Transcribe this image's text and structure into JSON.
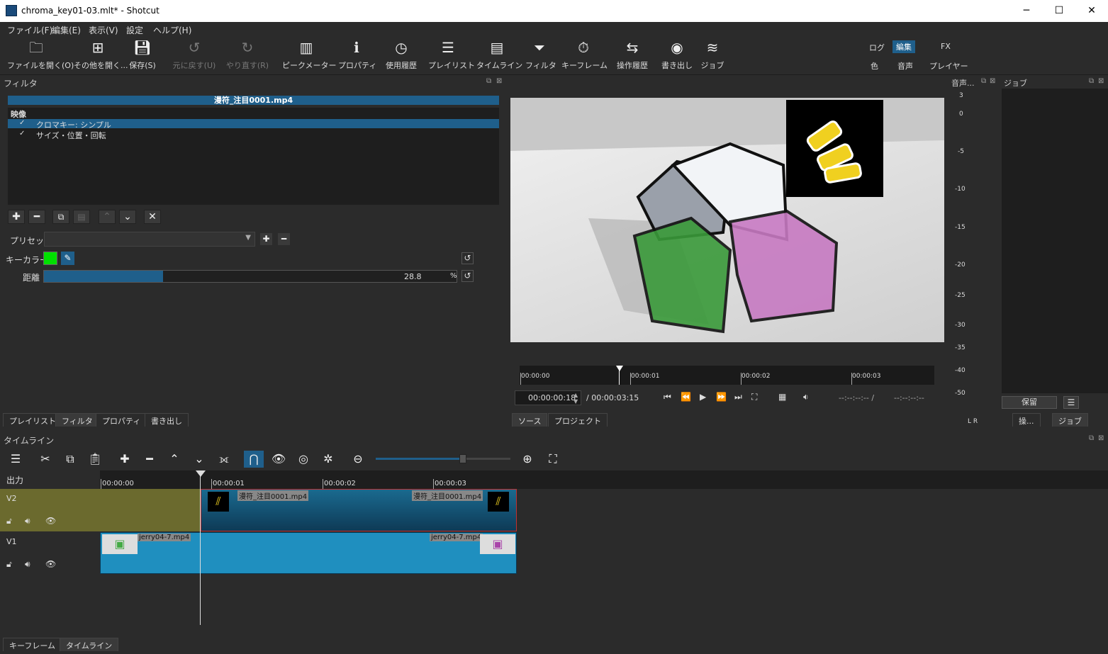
{
  "window": {
    "title": "chroma_key01-03.mlt* - Shotcut",
    "min": "─",
    "max": "☐",
    "close": "✕"
  },
  "menu": [
    "ファイル(F)",
    "編集(E)",
    "表示(V)",
    "設定",
    "ヘルプ(H)"
  ],
  "toolbar": {
    "open": "ファイルを開く(O)",
    "open_other": "その他を開く...",
    "save": "保存(S)",
    "undo": "元に戻す(U)",
    "redo": "やり直す(R)",
    "peak": "ピークメーター",
    "props": "プロパティ",
    "history": "使用履歴",
    "playlist": "プレイリスト",
    "timeline": "タイムライン",
    "filter": "フィルタ",
    "keyframe": "キーフレーム",
    "ophistory": "操作履歴",
    "export": "書き出し",
    "jobs": "ジョブ"
  },
  "layouts": {
    "log": "ログ",
    "edit": "編集",
    "fx": "FX",
    "color": "色",
    "audio": "音声",
    "player": "プレイヤー"
  },
  "filters": {
    "title": "フィルタ",
    "clip": "漫符_注目0001.mp4",
    "section": "映像",
    "items": [
      {
        "label": "クロマキー: シンプル",
        "checked": "✓"
      },
      {
        "label": "サイズ・位置・回転",
        "checked": "✓"
      }
    ],
    "preset_label": "プリセット",
    "key_color_label": "キーカラー",
    "key_color": "#00e000",
    "distance_label": "距離",
    "distance_value": "28.8",
    "distance_unit": "%",
    "distance_fraction": 0.288
  },
  "left_tabs": [
    "プレイリスト",
    "フィルタ",
    "プロパティ",
    "書き出し"
  ],
  "player": {
    "ruler": [
      "00:00:00",
      "00:00:01",
      "00:00:02",
      "00:00:03"
    ],
    "position": "00:00:00:18",
    "duration": "/ 00:00:03:15",
    "in_point": "--:--:--:-- /",
    "out_point": "--:--:--:--",
    "tabs": [
      "ソース",
      "プロジェクト"
    ]
  },
  "audio_meter": {
    "title": "音声...",
    "scale": [
      "3",
      "0",
      "-5",
      "-10",
      "-15",
      "-20",
      "-25",
      "-30",
      "-35",
      "-40",
      "-50"
    ],
    "lr": "L R"
  },
  "jobs": {
    "title": "ジョブ",
    "pause_button": "保留",
    "tabs": [
      "操...",
      "ジョブ"
    ]
  },
  "timeline": {
    "title": "タイムライン",
    "output_label": "出力",
    "ruler": [
      "00:00:00",
      "00:00:01",
      "00:00:02",
      "00:00:03"
    ],
    "tracks": [
      {
        "name": "V2",
        "clip_start": "漫符_注目0001.mp4",
        "clip_end": "漫符_注目0001.mp4"
      },
      {
        "name": "V1",
        "clip_start": "jerry04-7.mp4",
        "clip_end": "jerry04-7.mp4"
      }
    ],
    "zoom_fraction": 0.65
  },
  "bottom_tabs": [
    "キーフレーム",
    "タイムライン"
  ],
  "colors": {
    "accent": "#1f5f8b",
    "panel": "#2b2b2b",
    "v2_clip": "#1a5a7a",
    "v1_clip": "#1f8fbf",
    "v2_header": "#6b6a2e"
  }
}
